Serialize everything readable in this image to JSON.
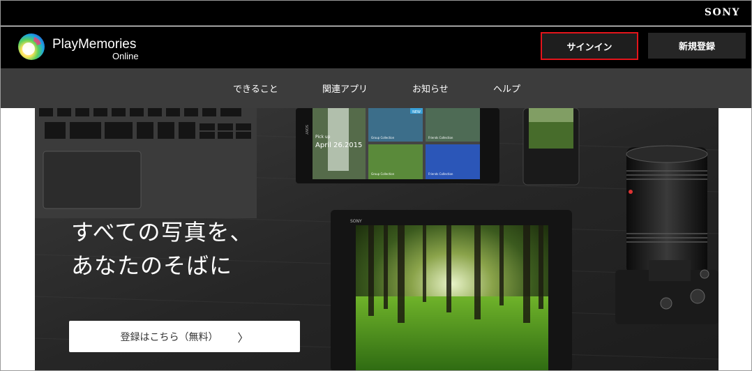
{
  "brand": {
    "sony": "SONY",
    "app_name": "PlayMemories",
    "app_sub": "Online"
  },
  "header": {
    "signin_label": "サインイン",
    "register_label": "新規登録"
  },
  "nav": {
    "items": [
      {
        "label": "できること"
      },
      {
        "label": "関連アプリ"
      },
      {
        "label": "お知らせ"
      },
      {
        "label": "ヘルプ"
      }
    ]
  },
  "hero": {
    "headline_line1": "すべての写真を、",
    "headline_line2": "あなたのそばに",
    "cta_label": "登録はこちら（無料）",
    "cta_chevron": "〉",
    "tablet_brand": "SONY",
    "phone_brand": "SONY",
    "pickup_label": "Pick up",
    "pickup_date": "April 26.2015",
    "new_badge": "NEW",
    "tile_labels": [
      "Group Collection",
      "Friends Collection",
      "Group Collection",
      "Friends Collection"
    ]
  },
  "colors": {
    "highlight_border": "#e4141b",
    "nav_bg": "#3c3c3c",
    "header_bg": "#000000"
  }
}
